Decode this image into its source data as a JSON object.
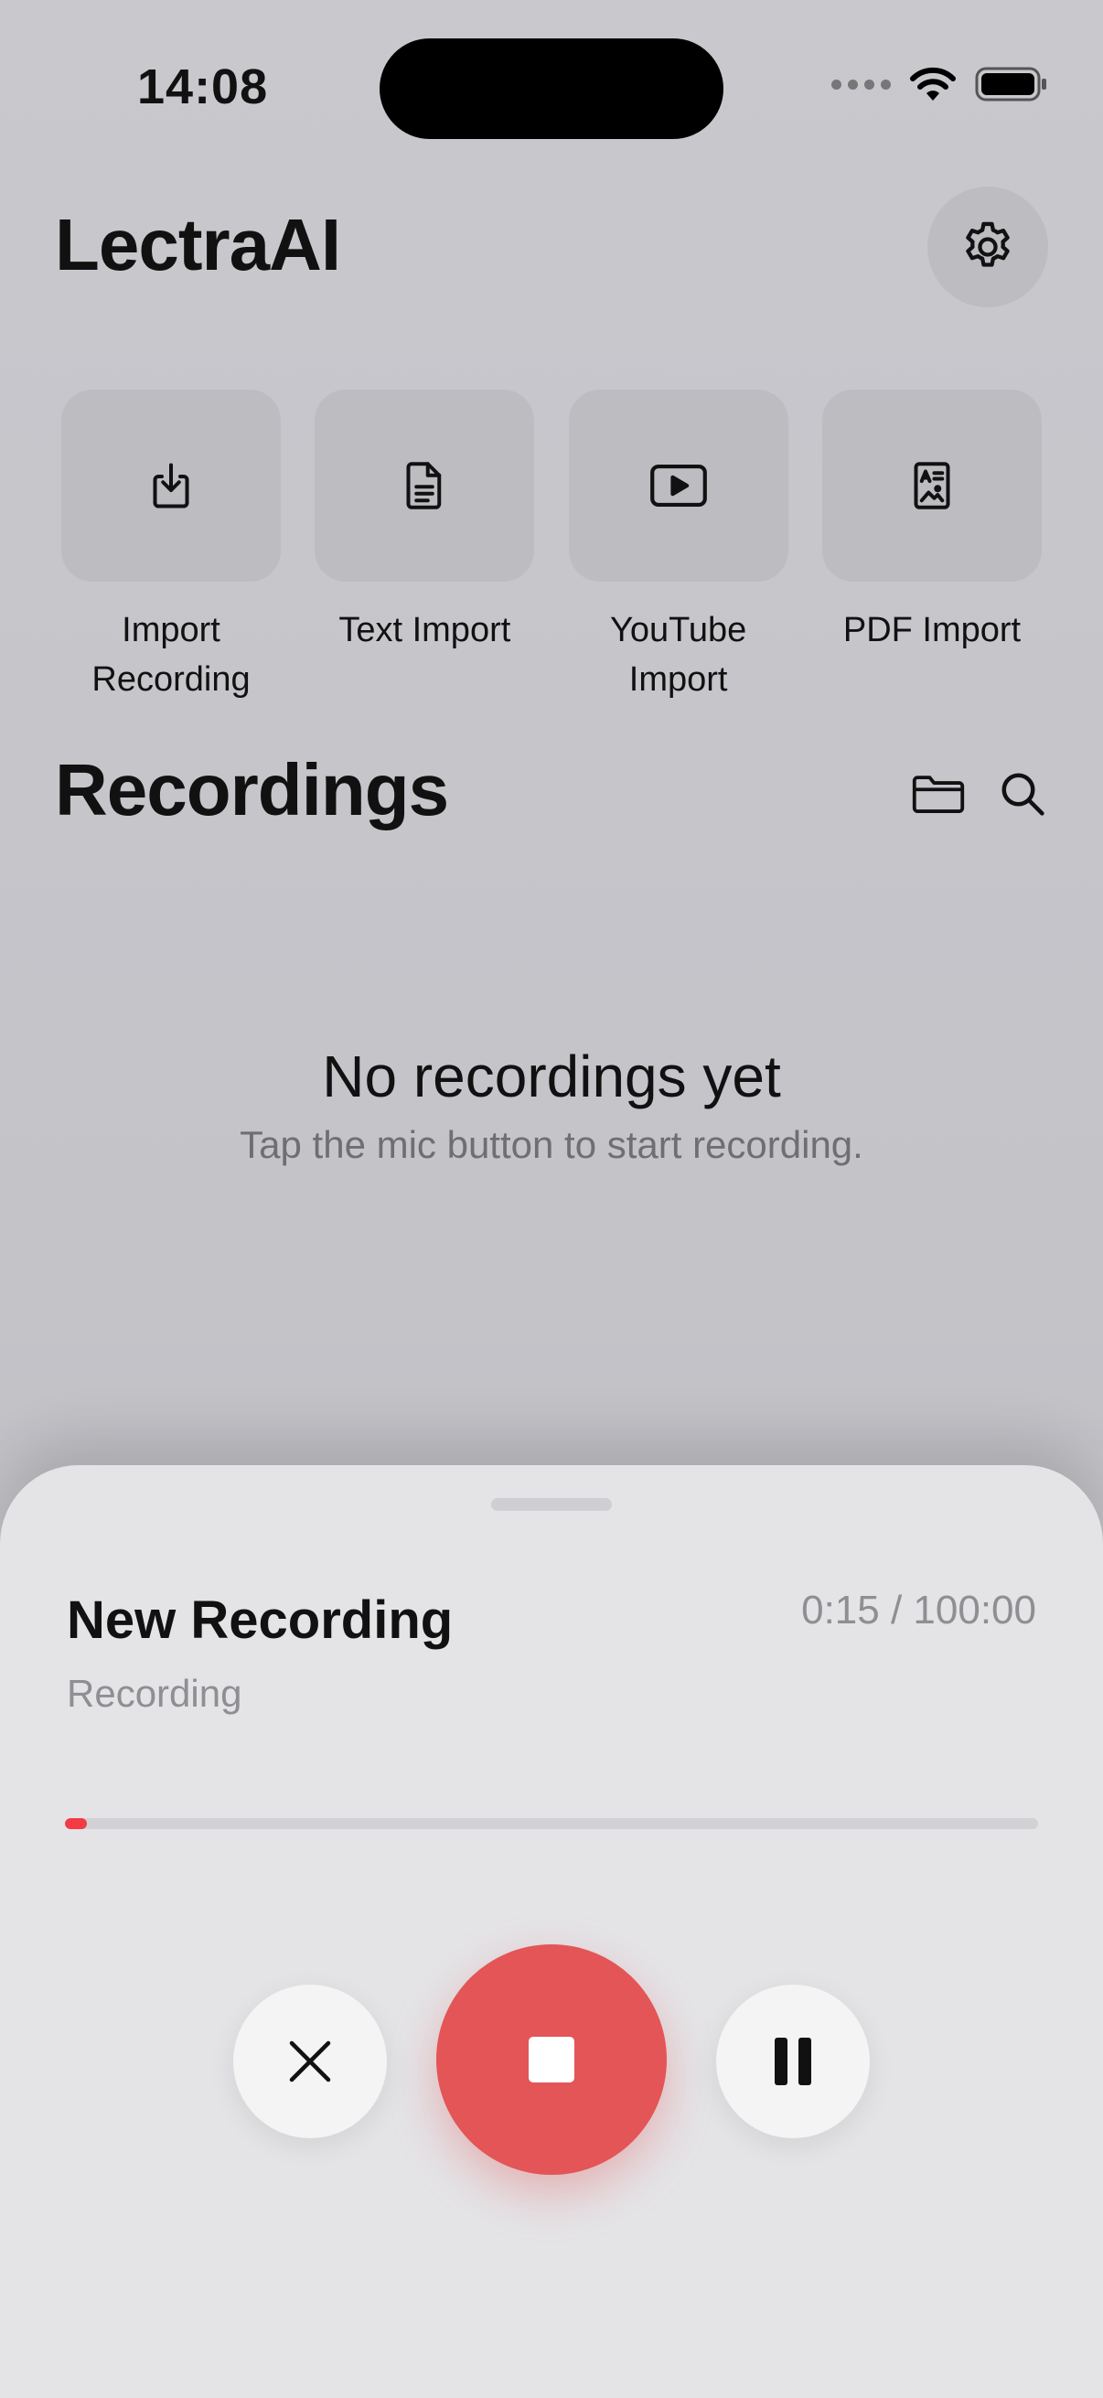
{
  "status_bar": {
    "time": "14:08"
  },
  "header": {
    "title": "LectraAI",
    "settings_icon": "gear-icon"
  },
  "import_actions": [
    {
      "label": "Import Recording",
      "icon": "download-tray-icon"
    },
    {
      "label": "Text Import",
      "icon": "document-text-icon"
    },
    {
      "label": "YouTube Import",
      "icon": "play-rectangle-icon"
    },
    {
      "label": "PDF Import",
      "icon": "pdf-document-icon"
    }
  ],
  "recordings": {
    "title": "Recordings",
    "folder_icon": "folder-icon",
    "search_icon": "search-icon",
    "empty_title": "No recordings yet",
    "empty_subtitle": "Tap the mic button to start recording."
  },
  "recorder_sheet": {
    "title": "New Recording",
    "elapsed": "0:15 / 100:00",
    "status": "Recording",
    "progress_fraction": 0.0025,
    "colors": {
      "stop": "#e35556",
      "progress": "#f23b45"
    }
  }
}
